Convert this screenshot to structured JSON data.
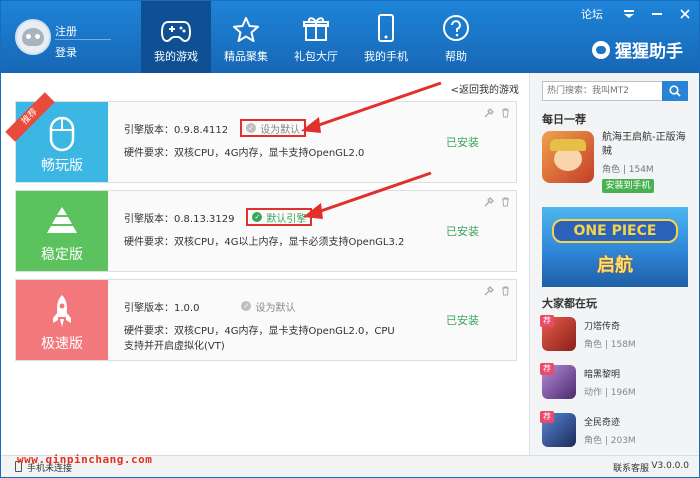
{
  "account": {
    "register": "注册",
    "login": "登录"
  },
  "nav": [
    {
      "label": "我的游戏",
      "icon": "gamepad-icon",
      "active": true
    },
    {
      "label": "精品聚集",
      "icon": "star-icon",
      "active": false
    },
    {
      "label": "礼包大厅",
      "icon": "gift-icon",
      "active": false
    },
    {
      "label": "我的手机",
      "icon": "phone-icon",
      "active": false
    },
    {
      "label": "帮助",
      "icon": "help-icon",
      "active": false
    }
  ],
  "window": {
    "forum": "论坛",
    "brand": "猩猩助手"
  },
  "main": {
    "back_link": "<返回我的游戏",
    "cards": [
      {
        "name": "畅玩版",
        "ribbon": "推荐",
        "color": "#3cb6e3",
        "engine": "引擎版本：0.9.8.4112",
        "default_label": "设为默认",
        "is_default": false,
        "highlighted": true,
        "requirement": "硬件要求：双核CPU，4G内存，显卡支持OpenGL2.0",
        "status": "已安装"
      },
      {
        "name": "稳定版",
        "ribbon": "",
        "color": "#5cc25e",
        "engine": "引擎版本：0.8.13.3129",
        "default_label": "默认引擎",
        "is_default": true,
        "highlighted": true,
        "requirement": "硬件要求：双核CPU，4G以上内存，显卡必须支持OpenGL3.2",
        "status": "已安装"
      },
      {
        "name": "极速版",
        "ribbon": "",
        "color": "#f2787c",
        "engine": "引擎版本：1.0.0",
        "default_label": "设为默认",
        "is_default": false,
        "highlighted": false,
        "requirement": "硬件要求：双核CPU，4G内存，显卡支持OpenGL2.0，CPU支持并开启虚拟化(VT)",
        "status": "已安装"
      }
    ]
  },
  "sidebar": {
    "search_placeholder": "热门搜索：我叫MT2",
    "daily_title": "每日一荐",
    "daily": {
      "name": "航海王启航-正版海贼",
      "meta": "角色 | 154M",
      "install": "安装到手机"
    },
    "banner": {
      "title": "ONE PIECE",
      "subtitle": "启航"
    },
    "popular_title": "大家都在玩",
    "popular": [
      {
        "name": "刀塔传奇",
        "meta": "角色 | 158M",
        "badge": "荐",
        "color": "#c0392b"
      },
      {
        "name": "暗黑黎明",
        "meta": "动作 | 196M",
        "badge": "荐",
        "color": "#7b4a9e"
      },
      {
        "name": "全民奇迹",
        "meta": "角色 | 203M",
        "badge": "荐",
        "color": "#2c4a8a"
      }
    ]
  },
  "footer": {
    "phone_status": "手机未连接",
    "contact": "联系客服",
    "version": "V3.0.0.0"
  },
  "watermark": "www.qinpinchang.com"
}
